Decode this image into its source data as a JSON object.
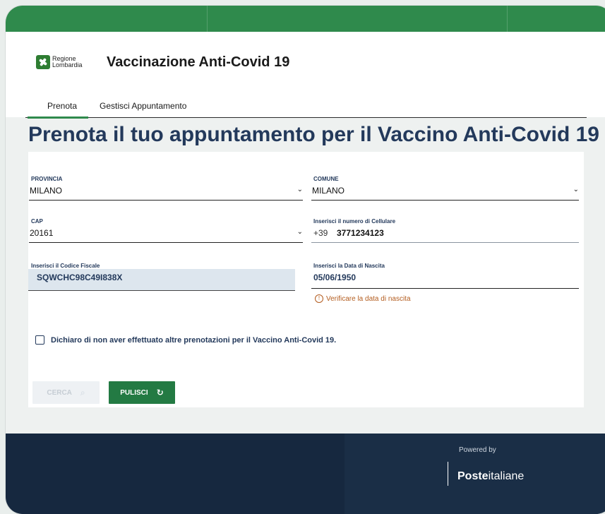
{
  "header": {
    "logo_line1": "Regione",
    "logo_line2": "Lombardia",
    "app_title": "Vaccinazione Anti-Covid 19"
  },
  "tabs": [
    {
      "label": "Prenota",
      "active": true
    },
    {
      "label": "Gestisci Appuntamento",
      "active": false
    }
  ],
  "page": {
    "title": "Prenota il tuo appuntamento per il Vaccino Anti-Covid 19"
  },
  "form": {
    "provincia": {
      "label": "PROVINCIA",
      "value": "MILANO"
    },
    "comune": {
      "label": "COMUNE",
      "value": "MILANO"
    },
    "cap": {
      "label": "CAP",
      "value": "20161"
    },
    "cellulare": {
      "label": "Inserisci il numero di Cellulare",
      "prefix": "+39",
      "value": "3771234123"
    },
    "codice_fiscale": {
      "label": "Inserisci il Codice Fiscale",
      "value": "SQWCHC98C49I838X"
    },
    "data_nascita": {
      "label": "Inserisci la Data di Nascita",
      "value": "05/06/1950",
      "warning": "Verificare la data di nascita"
    },
    "dichiarazione": "Dichiaro di non aver effettuato altre prenotazioni per il Vaccino Anti-Covid 19.",
    "cerca_label": "CERCA",
    "pulisci_label": "PULISCI"
  },
  "footer": {
    "powered_by": "Powered by",
    "brand_bold": "Poste",
    "brand_regular": "italiane"
  },
  "colors": {
    "primary_green": "#2f8a4c",
    "navy": "#23395b",
    "footer_bg": "#16283f",
    "warning": "#b35c1e"
  }
}
